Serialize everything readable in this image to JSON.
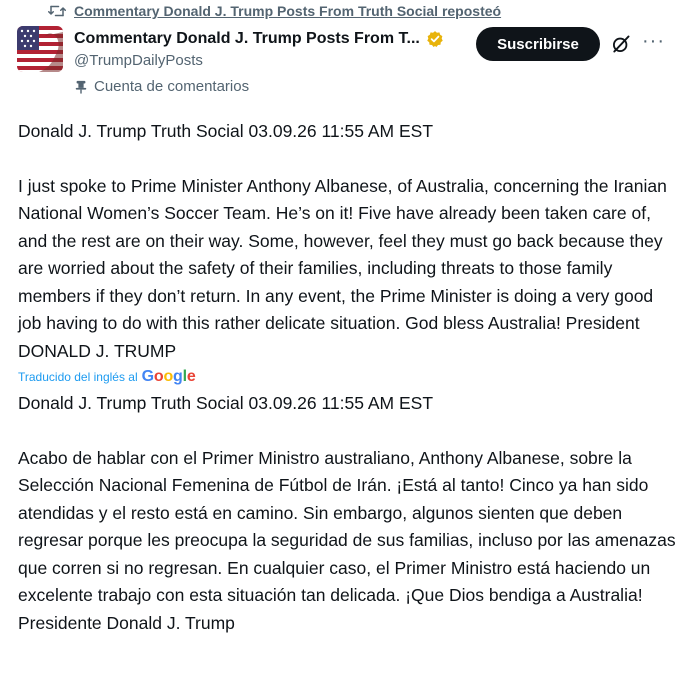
{
  "repost": {
    "label": "Commentary Donald J. Trump Posts From Truth Social reposteó"
  },
  "author": {
    "display_name": "Commentary Donald J. Trump Posts From T...",
    "handle": "@TrumpDailyPosts",
    "account_type": "Cuenta de comentarios",
    "verified": true
  },
  "actions": {
    "subscribe_label": "Suscribirse",
    "more_label": "···"
  },
  "original": {
    "header": "Donald J. Trump Truth Social 03.09.26 11:55 AM EST",
    "text": "I just spoke to Prime Minister Anthony Albanese, of Australia, concerning the Iranian National Women’s Soccer Team. He’s on it! Five have already been taken care of, and the rest are on their way. Some, however, feel they must go back because they are worried about the safety of their families, including threats to those family members if they don’t return. In any event, the Prime Minister is doing a very good job having to do with this rather delicate situation. God bless Australia! President DONALD J. TRUMP"
  },
  "translation_notice": {
    "label": "Traducido del inglés al",
    "brand": "Google"
  },
  "translated": {
    "header": "Donald J. Trump Truth Social 03.09.26 11:55 AM EST",
    "text": "Acabo de hablar con el Primer Ministro australiano, Anthony Albanese, sobre la Selección Nacional Femenina de Fútbol de Irán. ¡Está al tanto! Cinco ya han sido atendidas y el resto está en camino. Sin embargo, algunos sienten que deben regresar porque les preocupa la seguridad de sus familias, incluso por las amenazas que corren si no regresan. En cualquier caso, el Primer Ministro está haciendo un excelente trabajo con esta situación tan delicada. ¡Que Dios bendiga a Australia! Presidente Donald J. Trump"
  },
  "colors": {
    "text": "#0f1419",
    "muted": "#536471",
    "link": "#1d9bf0",
    "verified_badge": "#e8b30b",
    "button_bg": "#0f1419"
  },
  "icons": {
    "repost": "repost-icon",
    "verified": "verified-badge-icon",
    "grok": "grok-icon",
    "more": "more-icon",
    "account_type": "pin-icon"
  }
}
